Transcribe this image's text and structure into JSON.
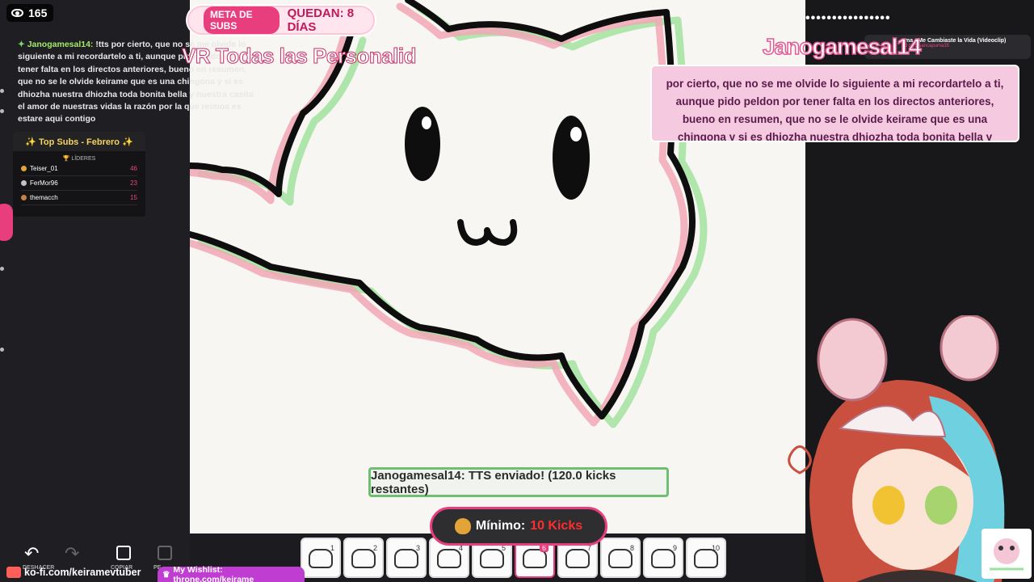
{
  "viewers": {
    "count": "165",
    "icon": "eye-icon"
  },
  "chat": {
    "username": "Janogamesal14:",
    "message": "!tts por cierto, que no se me olvide lo siguiente a mi recordartelo a ti, aunque pido peldon por tener falta en los directos anteriores, bueno en resumen, que no se le olvide keirame que es una chingona y si es dhiozha nuestra dhiozha toda bonita bella y nuestra casita el amor de nuestras vidas la razón por la que reimos es estare aqui contigo"
  },
  "top_subs": {
    "title": "✨ Top Subs - Febrero ✨",
    "leaders_label": "🏆 LÍDERES",
    "rows": [
      {
        "name": "Teiser_01",
        "value": "46"
      },
      {
        "name": "FerMor96",
        "value": "23"
      },
      {
        "name": "themacch",
        "value": "15"
      }
    ]
  },
  "sub_goal": {
    "label": "META DE SUBS",
    "remaining": "QUEDAN: 8 DÍAS"
  },
  "overlay_text": "VR Todas las Personalid",
  "alert": {
    "dots": "••••••••••••••••",
    "name": "Janogamesal14",
    "song_title": "ma - Me Cambiaste la Vida (Videoclip)",
    "song_sub": "d by: lisancapuma35",
    "tts_text": "por cierto, que no se me olvide lo siguiente a mi recordartelo a ti, aunque pido peldon por tener falta en los directos anteriores, bueno en resumen, que no se le olvide keirame que es una chingona y si es dhiozha nuestra dhiozha toda bonita bella y nuestra casita el amor de nuestras vidas la"
  },
  "tts_confirm": "Janogamesal14: TTS enviado! (120.0 kicks restantes)",
  "minimum": {
    "label": "Mínimo:",
    "value": "10 Kicks"
  },
  "frames": [
    "1",
    "2",
    "3",
    "4",
    "5",
    "6",
    "7",
    "8",
    "9",
    "10"
  ],
  "selected_frame": "6",
  "toolbar": {
    "undo_label": "DESHACER",
    "copy_label": "COPIAR",
    "paste_label": "PE"
  },
  "links": {
    "kofi": "ko-fi.com/keiramevtuber",
    "wishlist": "My Wishlist: throne.com/keirame"
  },
  "colors": {
    "accent": "#e83e7e",
    "canvas": "#f7f6f2",
    "green": "#6fbf73"
  }
}
